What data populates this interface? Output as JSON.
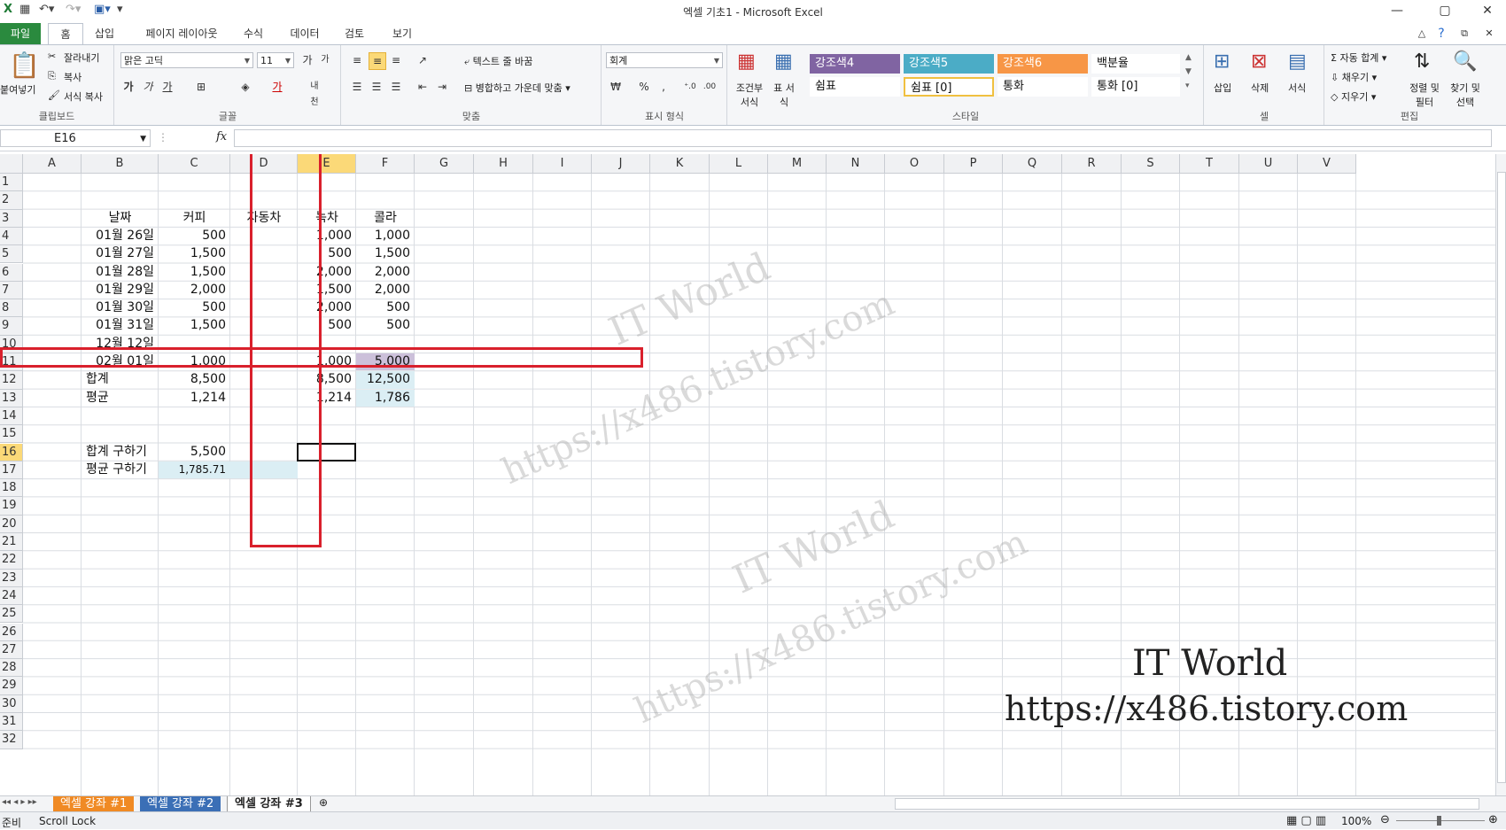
{
  "window": {
    "title": "엑셀 기초1 - Microsoft Excel"
  },
  "tabs": [
    "파일",
    "홈",
    "삽입",
    "페이지 레이아웃",
    "수식",
    "데이터",
    "검토",
    "보기"
  ],
  "ribbon": {
    "clipboard": {
      "label": "클립보드",
      "paste": "붙여넣기",
      "cut": "잘라내기",
      "copy": "복사",
      "format_copy": "서식 복사"
    },
    "font": {
      "label": "글꼴",
      "name": "맑은 고딕",
      "size": "11"
    },
    "align": {
      "label": "맞춤",
      "wrap": "텍스트 줄 바꿈",
      "merge": "병합하고 가운데 맞춤"
    },
    "number": {
      "label": "표시 형식",
      "format": "회계"
    },
    "styles": {
      "label": "스타일",
      "cond": "조건부 서식",
      "table": "표 서식",
      "items": [
        {
          "text": "강조색4",
          "bg": "#8064a2",
          "fg": "#ffffff"
        },
        {
          "text": "강조색5",
          "bg": "#4bacc6",
          "fg": "#ffffff"
        },
        {
          "text": "강조색6",
          "bg": "#f79646",
          "fg": "#ffffff"
        },
        {
          "text": "백분율",
          "bg": "#ffffff",
          "fg": "#111111"
        },
        {
          "text": "쉼표",
          "bg": "#ffffff",
          "fg": "#111111"
        },
        {
          "text": "쉼표 [0]",
          "bg": "#ffffff",
          "fg": "#111111"
        },
        {
          "text": "통화",
          "bg": "#ffffff",
          "fg": "#111111"
        },
        {
          "text": "통화 [0]",
          "bg": "#ffffff",
          "fg": "#111111"
        }
      ]
    },
    "cells": {
      "label": "셀",
      "insert": "삽입",
      "delete": "삭제",
      "format": "서식"
    },
    "editing": {
      "label": "편집",
      "autosum": "자동 합계",
      "fill": "채우기",
      "clear": "지우기",
      "sort": "정렬 및 필터",
      "find": "찾기 및 선택"
    }
  },
  "formula_bar": {
    "name_box": "E16",
    "fx": "fx",
    "value": ""
  },
  "columns": [
    "A",
    "B",
    "C",
    "D",
    "E",
    "F",
    "G",
    "H",
    "I",
    "J",
    "K",
    "L",
    "M",
    "N",
    "O",
    "P",
    "Q",
    "R",
    "S",
    "T",
    "U",
    "V"
  ],
  "rows": [
    "1",
    "2",
    "3",
    "4",
    "5",
    "6",
    "7",
    "8",
    "9",
    "10",
    "11",
    "12",
    "13",
    "14",
    "15",
    "16",
    "17",
    "18",
    "19",
    "20",
    "21",
    "22",
    "23",
    "24",
    "25",
    "26",
    "27",
    "28",
    "29",
    "30",
    "31",
    "32"
  ],
  "cells": {
    "B3": "날짜",
    "C3": "커피",
    "D3": "자동차",
    "E3": "녹차",
    "F3": "콜라",
    "B4": "01월 26일",
    "C4": "500",
    "E4": "1,000",
    "F4": "1,000",
    "B5": "01월 27일",
    "C5": "1,500",
    "E5": "500",
    "F5": "1,500",
    "B6": "01월 28일",
    "C6": "1,500",
    "E6": "2,000",
    "F6": "2,000",
    "B7": "01월 29일",
    "C7": "2,000",
    "E7": "1,500",
    "F7": "2,000",
    "B8": "01월 30일",
    "C8": "500",
    "E8": "2,000",
    "F8": "500",
    "B9": "01월 31일",
    "C9": "1,500",
    "E9": "500",
    "F9": "500",
    "B10": "12월 12일",
    "B11": "02월 01일",
    "C11": "1,000",
    "E11": "1,000",
    "F11": "5,000",
    "B12": "합계",
    "C12": "8,500",
    "E12": "8,500",
    "F12": "12,500",
    "B13": "평균",
    "C13": "1,214",
    "E13": "1,214",
    "F13": "1,786",
    "B16": "합계 구하기",
    "C16": "5,500",
    "B17": "평균 구하기",
    "C17": "1,785.71"
  },
  "watermark": {
    "line1": "IT World",
    "line2": "https://x486.tistory.com"
  },
  "sheets": [
    "엑셀 강좌 #1",
    "엑셀 강좌 #2",
    "엑셀 강좌 #3"
  ],
  "status": {
    "ready": "준비",
    "scroll_lock": "Scroll Lock",
    "zoom": "100%"
  },
  "colors": {
    "highlight_red": "#d9202c",
    "purple_fill": "#ccc0da",
    "blue_fill": "#dbeef4"
  }
}
